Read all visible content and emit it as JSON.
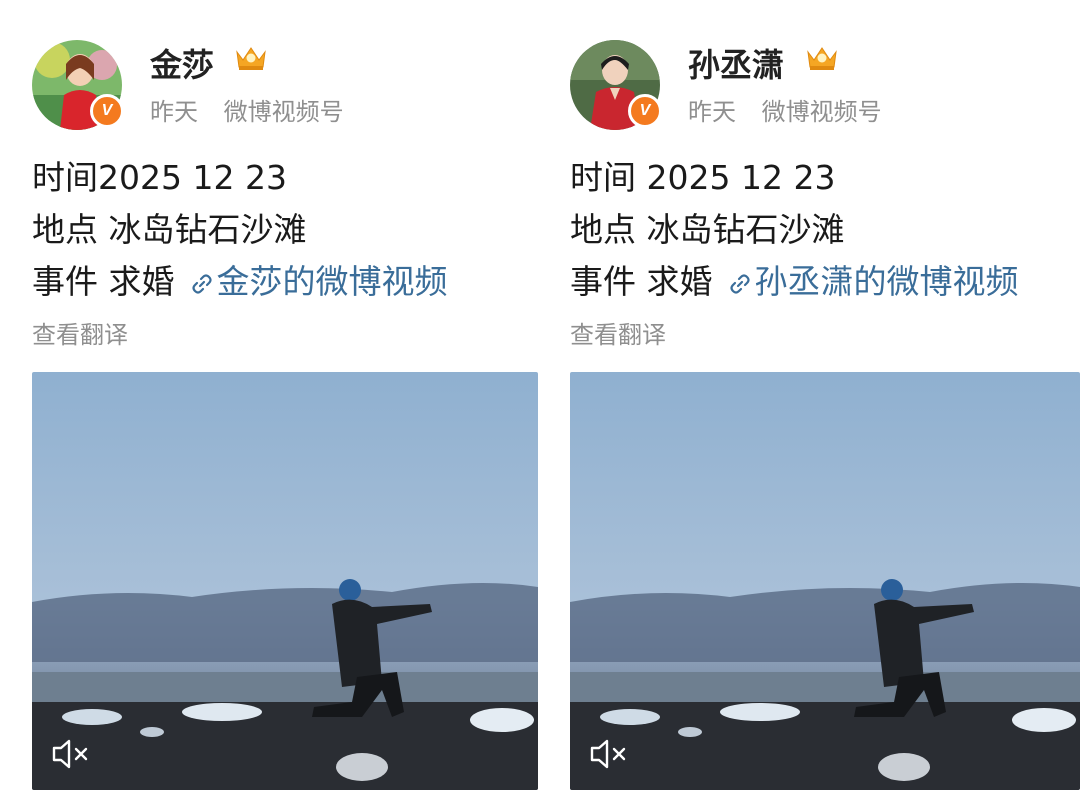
{
  "posts": [
    {
      "username": "金莎",
      "time": "昨天",
      "source": "微博视频号",
      "line1": "时间2025 12 23",
      "line2": "地点 冰岛钻石沙滩",
      "line3_prefix": "事件 求婚",
      "link_text": "金莎的微博视频",
      "translate": "查看翻译",
      "verified_badge": "V",
      "icons": [
        "crown-icon",
        "link-icon",
        "mute-icon"
      ]
    },
    {
      "username": "孙丞潇",
      "time": "昨天",
      "source": "微博视频号",
      "line1": "时间 2025 12 23",
      "line2": "地点 冰岛钻石沙滩",
      "line3_prefix": "事件 求婚",
      "link_text": "孙丞潇的微博视频",
      "translate": "查看翻译",
      "verified_badge": "V",
      "icons": [
        "crown-icon",
        "link-icon",
        "mute-icon"
      ]
    }
  ],
  "colors": {
    "link": "#3a6d99",
    "meta": "#8f8f8f",
    "verified": "#f47a1f",
    "crown": "#f5a623"
  }
}
